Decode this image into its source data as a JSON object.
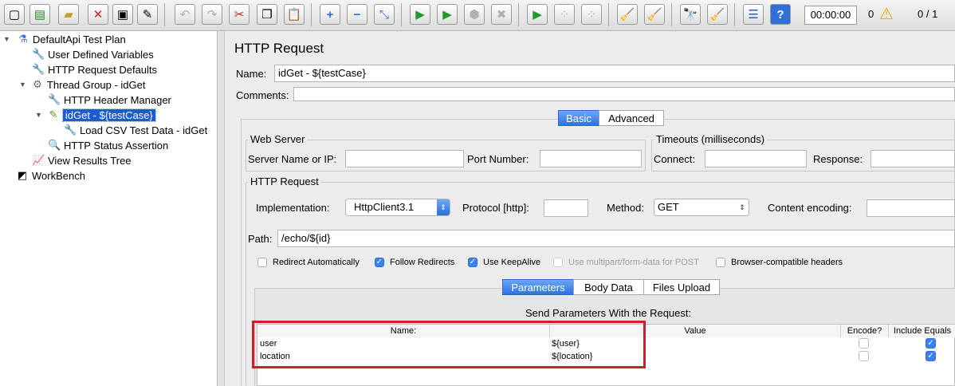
{
  "toolbar": {
    "timer": "00:00:00",
    "error_count": "0",
    "threads": "0 / 1",
    "icons": [
      "new-icon",
      "templates-icon",
      "open-icon",
      "close-icon",
      "save-icon",
      "save-as-icon",
      "undo-icon",
      "redo-icon",
      "cut-icon",
      "copy-icon",
      "paste-icon",
      "expand-icon",
      "collapse-icon",
      "toggle-icon",
      "start-icon",
      "start-no-pause-icon",
      "stop-icon",
      "shutdown-icon",
      "remote-start-icon",
      "remote-stop-icon",
      "remote-shutdown-icon",
      "clear-icon",
      "clear-all-icon",
      "search-icon",
      "reset-search-icon",
      "function-helper-icon",
      "help-icon",
      "warning-icon"
    ]
  },
  "tree": {
    "items": [
      {
        "label": "DefaultApi Test Plan",
        "icon": "test-plan-icon"
      },
      {
        "label": "User Defined Variables",
        "icon": "config-wrench-icon"
      },
      {
        "label": "HTTP Request Defaults",
        "icon": "config-wrench-icon"
      },
      {
        "label": "Thread Group - idGet",
        "icon": "thread-group-gear-icon"
      },
      {
        "label": "HTTP Header Manager",
        "icon": "config-wrench-icon"
      },
      {
        "label": "idGet - ${testCase}",
        "icon": "sampler-pen-icon"
      },
      {
        "label": "Load CSV Test Data - idGet",
        "icon": "config-wrench-icon"
      },
      {
        "label": "HTTP Status Assertion",
        "icon": "assertion-magnifier-icon"
      },
      {
        "label": "View Results Tree",
        "icon": "listener-graph-icon"
      },
      {
        "label": "WorkBench",
        "icon": "workbench-icon"
      }
    ]
  },
  "panel": {
    "title": "HTTP Request",
    "name_label": "Name:",
    "name_value": "idGet - ${testCase}",
    "comments_label": "Comments:",
    "tabs": [
      "Basic",
      "Advanced"
    ],
    "web_server": {
      "legend": "Web Server",
      "server_label": "Server Name or IP:",
      "port_label": "Port Number:"
    },
    "timeouts": {
      "legend": "Timeouts (milliseconds)",
      "connect_label": "Connect:",
      "response_label": "Response:"
    },
    "http_request": {
      "legend": "HTTP Request",
      "implementation_label": "Implementation:",
      "implementation_value": "HttpClient3.1",
      "protocol_label": "Protocol [http]:",
      "method_label": "Method:",
      "method_value": "GET",
      "encoding_label": "Content encoding:",
      "path_label": "Path:",
      "path_value": "/echo/${id}"
    },
    "checkboxes": [
      {
        "label": "Redirect Automatically",
        "checked": false,
        "enabled": true
      },
      {
        "label": "Follow Redirects",
        "checked": true,
        "enabled": true
      },
      {
        "label": "Use KeepAlive",
        "checked": true,
        "enabled": true
      },
      {
        "label": "Use multipart/form-data for POST",
        "checked": false,
        "enabled": false
      },
      {
        "label": "Browser-compatible headers",
        "checked": false,
        "enabled": true
      }
    ],
    "param_tabs": [
      "Parameters",
      "Body Data",
      "Files Upload"
    ],
    "params_title": "Send Parameters With the Request:",
    "table": {
      "columns": [
        "Name:",
        "Value",
        "Encode?",
        "Include Equals"
      ],
      "rows": [
        {
          "name": "user",
          "value": "${user}",
          "encode": false,
          "include_equals": true
        },
        {
          "name": "location",
          "value": "${location}",
          "encode": false,
          "include_equals": true
        }
      ]
    }
  }
}
